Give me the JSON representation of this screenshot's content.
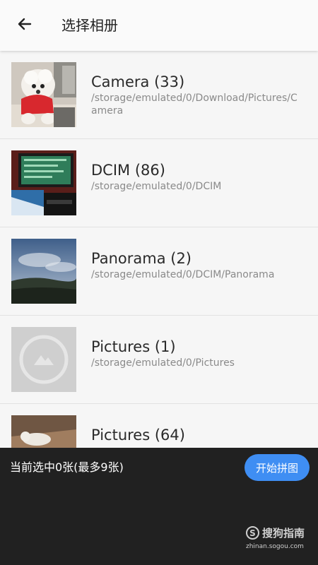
{
  "header": {
    "title": "选择相册",
    "back_icon": "arrow-left-icon"
  },
  "albums": [
    {
      "name": "Camera (33)",
      "path": "/storage/emulated/0/Download/Pictures/Camera",
      "thumb": "dog-photo"
    },
    {
      "name": "DCIM (86)",
      "path": "/storage/emulated/0/DCIM",
      "thumb": "monitor-photo"
    },
    {
      "name": "Panorama (2)",
      "path": "/storage/emulated/0/DCIM/Panorama",
      "thumb": "landscape-photo"
    },
    {
      "name": "Pictures (1)",
      "path": "/storage/emulated/0/Pictures",
      "thumb": "image-placeholder-icon"
    },
    {
      "name": "Pictures (64)",
      "path": "",
      "thumb": "cat-photo"
    }
  ],
  "footer": {
    "selection_text": "当前选中0张(最多9张)",
    "start_button": "开始拼图",
    "watermark_logo": "搜狗指南",
    "watermark_url": "zhinan.sogou.com"
  },
  "colors": {
    "accent": "#3f8ef3",
    "bottom_bar": "#212121",
    "app_bar": "#fafafa"
  }
}
